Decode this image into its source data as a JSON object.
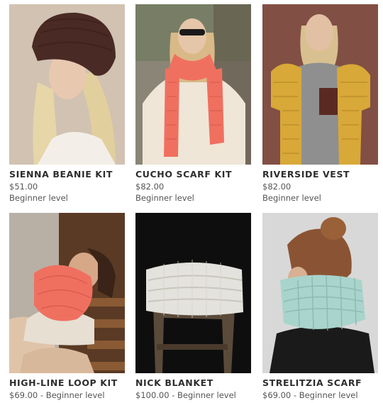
{
  "products": [
    {
      "name": "SIENNA BEANIE KIT",
      "price": "$51.00",
      "level": "Beginner level",
      "photo": "woman in brown chunky knit beanie"
    },
    {
      "name": "CUCHO SCARF KIT",
      "price": "$82.00",
      "level": "Beginner level",
      "photo": "woman in coral knit scarf and sunglasses"
    },
    {
      "name": "RIVERSIDE VEST",
      "price": "$82.00",
      "level": "Beginner level",
      "photo": "woman in mustard knit vest"
    },
    {
      "name": "HIGH-LINE LOOP KIT",
      "meta": "$69.00 - Beginner level",
      "photo": "woman in coral loop scarf on steps"
    },
    {
      "name": "NICK BLANKET",
      "meta": "$100.00 - Beginner level",
      "photo": "folded white knit blanket on stool"
    },
    {
      "name": "STRELITZIA SCARF",
      "meta": "$69.00 - Beginner level",
      "photo": "woman in mint knit snood"
    }
  ],
  "colors": {
    "coral": "#f07060",
    "mustard": "#d8a838",
    "mint": "#a8d4cc",
    "brown_knit": "#4a2a24"
  }
}
